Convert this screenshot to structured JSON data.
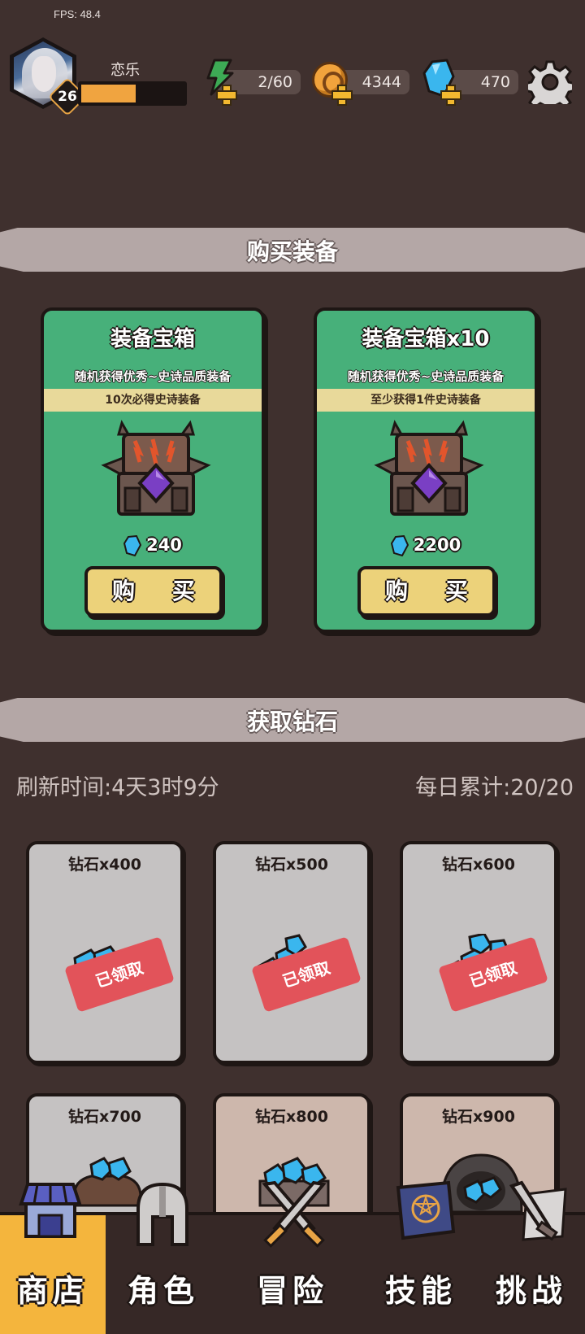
{
  "fps": "FPS: 48.4",
  "player": {
    "name": "恋乐",
    "level": "26",
    "exp_fraction": 0.55
  },
  "resources": {
    "energy": "2/60",
    "coins": "4344",
    "gems": "470"
  },
  "section_buy": {
    "title": "购买装备"
  },
  "chests": [
    {
      "title": "装备宝箱",
      "desc": "随机获得优秀~史诗品质装备",
      "note": "10次必得史诗装备",
      "price": "240",
      "buy_label": "购 买"
    },
    {
      "title": "装备宝箱x10",
      "desc": "随机获得优秀~史诗品质装备",
      "note": "至少获得1件史诗装备",
      "price": "2200",
      "buy_label": "购 买"
    }
  ],
  "section_gems": {
    "title": "获取钻石"
  },
  "refresh": "刷新时间:4天3时9分",
  "daily": "每日累计:20/20",
  "diamond_offers": [
    {
      "label": "钻石x400",
      "status": "已领取"
    },
    {
      "label": "钻石x500",
      "status": "已领取"
    },
    {
      "label": "钻石x600",
      "status": "已领取"
    },
    {
      "label": "钻石x700",
      "status": ""
    },
    {
      "label": "钻石x800",
      "status": ""
    },
    {
      "label": "钻石x900",
      "status": ""
    }
  ],
  "nav": [
    {
      "label": "商店",
      "icon": "shop-icon",
      "active": true
    },
    {
      "label": "角色",
      "icon": "helmet-icon",
      "active": false
    },
    {
      "label": "冒险",
      "icon": "crossed-swords-icon",
      "active": false
    },
    {
      "label": "技能",
      "icon": "spellbook-icon",
      "active": false
    },
    {
      "label": "挑战",
      "icon": "sword-scroll-icon",
      "active": false
    }
  ],
  "colors": {
    "accent": "#f4b53d",
    "card_green": "#47b07a",
    "claimed_red": "#e2535a",
    "background": "#3f302e"
  }
}
